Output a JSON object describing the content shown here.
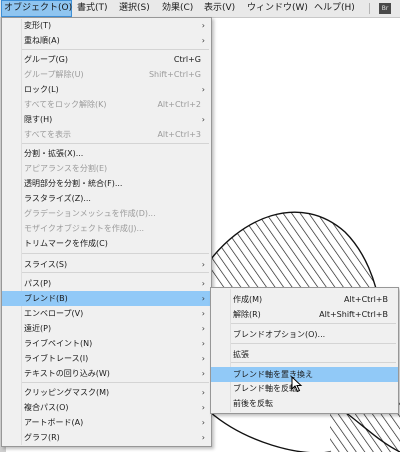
{
  "menubar": {
    "items": [
      "オブジェクト(O)",
      "書式(T)",
      "選択(S)",
      "効果(C)",
      "表示(V)",
      "ウィンドウ(W)",
      "ヘルプ(H)"
    ],
    "bridge_icon": "Br"
  },
  "object_menu": {
    "items": [
      {
        "label": "変形(T)",
        "shortcut": "",
        "submenu": true,
        "disabled": false
      },
      {
        "label": "重ね順(A)",
        "shortcut": "",
        "submenu": true,
        "disabled": false
      },
      {
        "label": "グループ(G)",
        "shortcut": "Ctrl+G",
        "submenu": false,
        "disabled": false
      },
      {
        "label": "グループ解除(U)",
        "shortcut": "Shift+Ctrl+G",
        "submenu": false,
        "disabled": true
      },
      {
        "label": "ロック(L)",
        "shortcut": "",
        "submenu": true,
        "disabled": false
      },
      {
        "label": "すべてをロック解除(K)",
        "shortcut": "Alt+Ctrl+2",
        "submenu": false,
        "disabled": true
      },
      {
        "label": "隠す(H)",
        "shortcut": "",
        "submenu": true,
        "disabled": false
      },
      {
        "label": "すべてを表示",
        "shortcut": "Alt+Ctrl+3",
        "submenu": false,
        "disabled": true
      },
      {
        "label": "分割・拡張(X)...",
        "shortcut": "",
        "submenu": false,
        "disabled": false
      },
      {
        "label": "アピアランスを分割(E)",
        "shortcut": "",
        "submenu": false,
        "disabled": true
      },
      {
        "label": "透明部分を分割・統合(F)...",
        "shortcut": "",
        "submenu": false,
        "disabled": false
      },
      {
        "label": "ラスタライズ(Z)...",
        "shortcut": "",
        "submenu": false,
        "disabled": false
      },
      {
        "label": "グラデーションメッシュを作成(D)...",
        "shortcut": "",
        "submenu": false,
        "disabled": true
      },
      {
        "label": "モザイクオブジェクトを作成(J)...",
        "shortcut": "",
        "submenu": false,
        "disabled": true
      },
      {
        "label": "トリムマークを作成(C)",
        "shortcut": "",
        "submenu": false,
        "disabled": false
      },
      {
        "label": "スライス(S)",
        "shortcut": "",
        "submenu": true,
        "disabled": false
      },
      {
        "label": "パス(P)",
        "shortcut": "",
        "submenu": true,
        "disabled": false
      },
      {
        "label": "ブレンド(B)",
        "shortcut": "",
        "submenu": true,
        "disabled": false,
        "highlight": true
      },
      {
        "label": "エンベロープ(V)",
        "shortcut": "",
        "submenu": true,
        "disabled": false
      },
      {
        "label": "遠近(P)",
        "shortcut": "",
        "submenu": true,
        "disabled": false
      },
      {
        "label": "ライブペイント(N)",
        "shortcut": "",
        "submenu": true,
        "disabled": false
      },
      {
        "label": "ライブトレース(I)",
        "shortcut": "",
        "submenu": true,
        "disabled": false
      },
      {
        "label": "テキストの回り込み(W)",
        "shortcut": "",
        "submenu": true,
        "disabled": false
      },
      {
        "label": "クリッピングマスク(M)",
        "shortcut": "",
        "submenu": true,
        "disabled": false
      },
      {
        "label": "複合パス(O)",
        "shortcut": "",
        "submenu": true,
        "disabled": false
      },
      {
        "label": "アートボード(A)",
        "shortcut": "",
        "submenu": true,
        "disabled": false
      },
      {
        "label": "グラフ(R)",
        "shortcut": "",
        "submenu": true,
        "disabled": false
      }
    ]
  },
  "blend_submenu": {
    "items": [
      {
        "label": "作成(M)",
        "shortcut": "Alt+Ctrl+B",
        "disabled": false
      },
      {
        "label": "解除(R)",
        "shortcut": "Alt+Shift+Ctrl+B",
        "disabled": false
      },
      {
        "label": "ブレンドオプション(O)...",
        "shortcut": "",
        "disabled": false
      },
      {
        "label": "拡張",
        "shortcut": "",
        "disabled": false
      },
      {
        "label": "ブレンド軸を置き換え",
        "shortcut": "",
        "disabled": false,
        "highlight": true
      },
      {
        "label": "ブレンド軸を反転",
        "shortcut": "",
        "disabled": false
      },
      {
        "label": "前後を反転",
        "shortcut": "",
        "disabled": false
      }
    ]
  },
  "colors": {
    "highlight": "#91c9f7",
    "active_menu": "#8fc5f0",
    "disabled_text": "#9b9b9b"
  }
}
